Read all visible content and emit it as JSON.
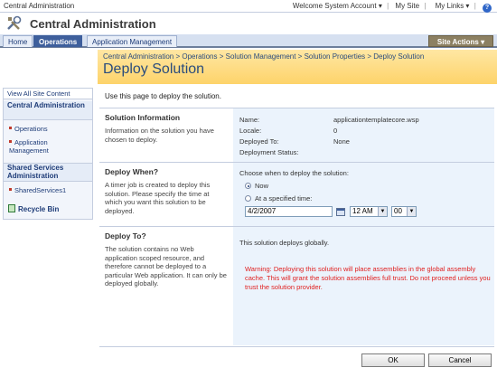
{
  "topbar": {
    "site_name": "Central Administration",
    "welcome": "Welcome System Account",
    "my_site": "My Site",
    "my_links": "My Links"
  },
  "header": {
    "title": "Central Administration"
  },
  "tabs": [
    {
      "label": "Home",
      "active": false
    },
    {
      "label": "Operations",
      "active": true
    },
    {
      "label": "Application Management",
      "active": false
    }
  ],
  "site_actions": "Site Actions",
  "breadcrumb": "Central Administration > Operations > Solution Management > Solution Properties > Deploy Solution",
  "page_title": "Deploy Solution",
  "nav": {
    "view_all": "View All Site Content",
    "section1": "Central Administration",
    "items1": [
      "Operations",
      "Application Management"
    ],
    "section2": "Shared Services Administration",
    "items2": [
      "SharedServices1"
    ],
    "recycle_bin": "Recycle Bin"
  },
  "intro": "Use this page to deploy the solution.",
  "solution_info": {
    "heading": "Solution Information",
    "desc": "Information on the solution you have chosen to deploy.",
    "fields": [
      {
        "label": "Name:",
        "value": "applicationtemplatecore.wsp"
      },
      {
        "label": "Locale:",
        "value": "0"
      },
      {
        "label": "Deployed To:",
        "value": "None"
      },
      {
        "label": "Deployment Status:",
        "value": ""
      }
    ]
  },
  "deploy_when": {
    "heading": "Deploy When?",
    "desc": "A timer job is created to deploy this solution. Please specify the time at which you want this solution to be deployed.",
    "prompt": "Choose when to deploy the solution:",
    "option_now": "Now",
    "option_specified": "At a specified time:",
    "selected": "Now",
    "date": "4/2/2007",
    "hour": "12 AM",
    "minute": "00"
  },
  "deploy_to": {
    "heading": "Deploy To?",
    "desc": "The solution contains no Web application scoped resource, and therefore cannot be deployed to a particular Web application. It can only be deployed globally.",
    "info": "This solution deploys globally.",
    "warning": "Warning: Deploying this solution will place assemblies in the global assembly cache. This will grant the solution assemblies full trust. Do not proceed unless you trust the solution provider."
  },
  "buttons": {
    "ok": "OK",
    "cancel": "Cancel"
  },
  "colors": {
    "warning": "#e02020",
    "title_band": "#fdd36a",
    "tab_active": "#3e5f9c"
  }
}
